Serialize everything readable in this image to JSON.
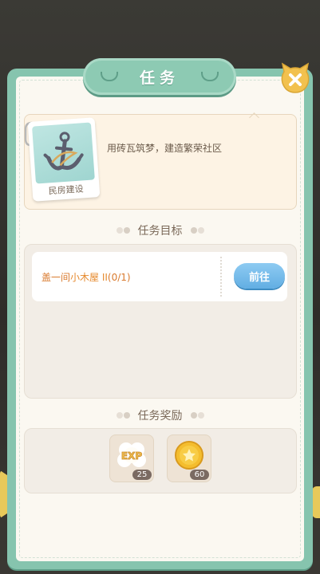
{
  "window": {
    "title": "任务"
  },
  "task": {
    "card_label": "民房建设",
    "card_icon": "anchor-icon",
    "description": "用砖瓦筑梦，建造繁荣社区"
  },
  "sections": {
    "objectives_title": "任务目标",
    "rewards_title": "任务奖励"
  },
  "objectives": [
    {
      "prefix": "盖一间",
      "highlight": "小木屋 II",
      "progress": "(0/1)",
      "current": 0,
      "target": 1,
      "button_label": "前往"
    }
  ],
  "rewards": [
    {
      "icon": "exp-icon",
      "icon_text": "EXP",
      "count": "25"
    },
    {
      "icon": "coin-icon",
      "count": "60"
    }
  ],
  "colors": {
    "panel": "#86c4ae",
    "accent_orange": "#e68a2e",
    "button_blue": "#62aee3",
    "close_yellow": "#f2c14e"
  }
}
